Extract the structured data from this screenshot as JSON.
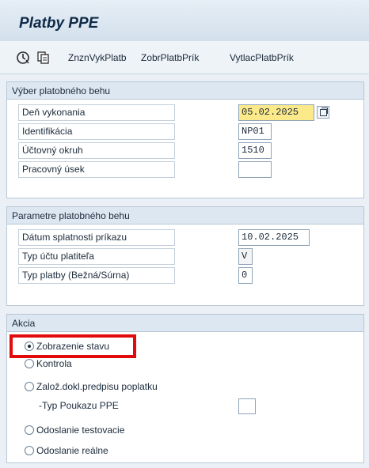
{
  "window": {
    "title": "Platby PPE"
  },
  "toolbar": {
    "execute_icon": "execute-clock-icon",
    "variant_icon": "get-variant-icon",
    "buttons": [
      "ZnznVykPlatb",
      "ZobrPlatbPrík",
      "VytlacPlatbPrík"
    ]
  },
  "selection": {
    "title": "Výber platobného behu",
    "fields": [
      {
        "label": "Deň vykonania",
        "value": "05.02.2025"
      },
      {
        "label": "Identifikácia",
        "value": "NP01"
      },
      {
        "label": "Účtovný okruh",
        "value": "1510"
      },
      {
        "label": "Pracovný úsek",
        "value": ""
      }
    ]
  },
  "params": {
    "title": "Parametre platobného behu",
    "fields": [
      {
        "label": "Dátum splatnosti príkazu",
        "value": "10.02.2025"
      },
      {
        "label": "Typ účtu platiteľa",
        "value": "V"
      },
      {
        "label": "Typ platby (Bežná/Súrna)",
        "value": "0"
      }
    ]
  },
  "action": {
    "title": "Akcia",
    "options": [
      {
        "label": "Zobrazenie stavu",
        "selected": true
      },
      {
        "label": "Kontrola",
        "selected": false
      },
      {
        "label": "Založ.dokl.predpisu poplatku",
        "selected": false
      },
      {
        "label": "Odoslanie testovacie",
        "selected": false
      },
      {
        "label": "Odoslanie reálne",
        "selected": false
      }
    ],
    "subfield": {
      "label": "-Typ Poukazu PPE",
      "value": ""
    }
  },
  "colors": {
    "highlight_box": "#e10b0b",
    "group_header_bg": "#dde7f1",
    "focused_field_bg": "#fbe98a"
  }
}
